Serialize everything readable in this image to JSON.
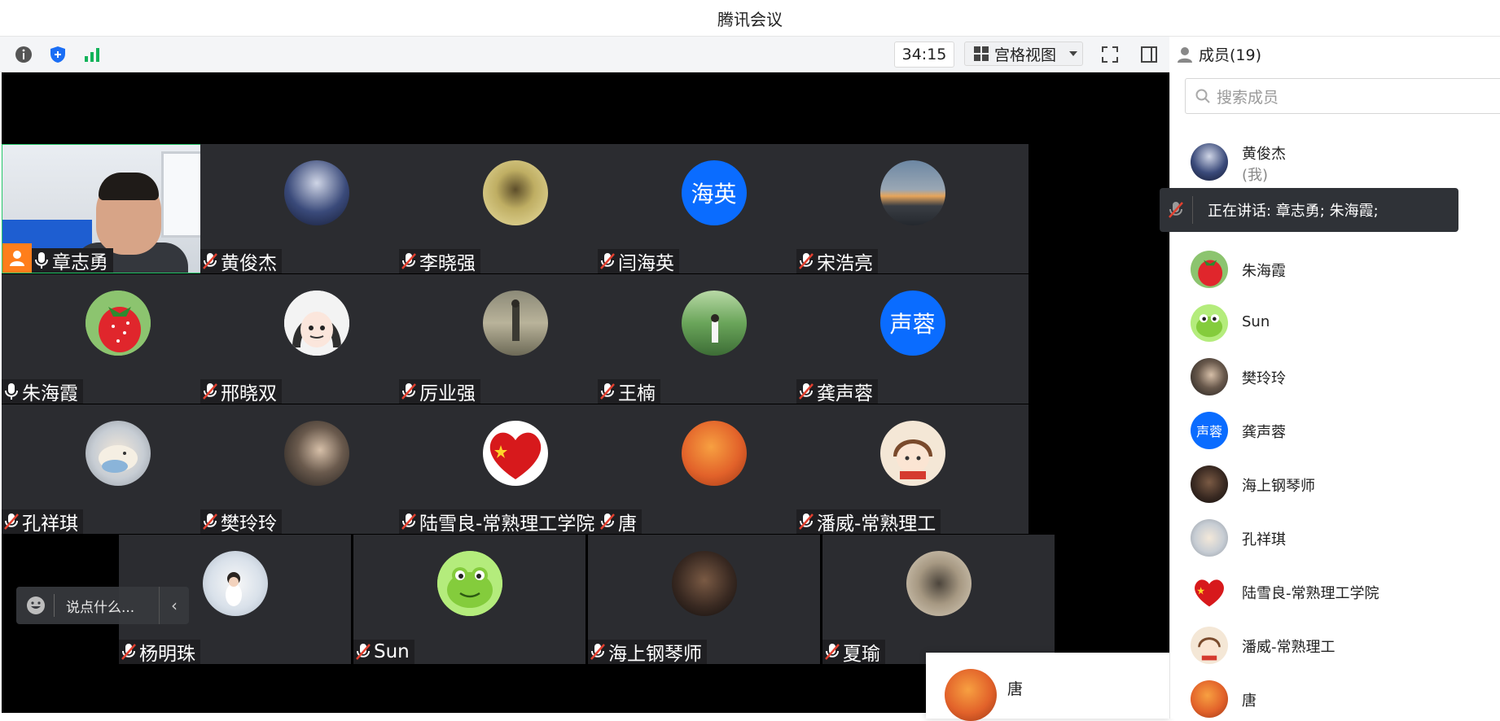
{
  "window": {
    "title": "腾讯会议"
  },
  "toolbar": {
    "timer": "34:15",
    "view_label": "宫格视图",
    "info_icon": "info-icon",
    "shield_icon": "shield-icon",
    "signal_icon": "signal-icon",
    "fullscreen_icon": "fullscreen-icon",
    "sidebar_icon": "sidebar-toggle-icon"
  },
  "members_panel": {
    "title": "成员(19)",
    "search_placeholder": "搜索成员",
    "speaking_toast": "正在讲话: 章志勇; 朱海霞;",
    "members": [
      {
        "name": "黄俊杰",
        "sub": "(我)"
      },
      {
        "name": "朱海霞"
      },
      {
        "name": "Sun"
      },
      {
        "name": "樊玲玲"
      },
      {
        "name": "龚声蓉",
        "avatar_text": "声蓉"
      },
      {
        "name": "海上钢琴师"
      },
      {
        "name": "孔祥琪"
      },
      {
        "name": "陆雪良-常熟理工学院"
      },
      {
        "name": "潘威-常熟理工"
      },
      {
        "name": "唐"
      }
    ]
  },
  "grid": {
    "tiles": [
      {
        "name": "章志勇",
        "mic": "on"
      },
      {
        "name": "黄俊杰",
        "mic": "off"
      },
      {
        "name": "李晓强",
        "mic": "off"
      },
      {
        "name": "闫海英",
        "mic": "off",
        "avatar_text": "海英"
      },
      {
        "name": "宋浩亮",
        "mic": "off"
      },
      {
        "name": "朱海霞",
        "mic": "on"
      },
      {
        "name": "邢晓双",
        "mic": "off"
      },
      {
        "name": "厉业强",
        "mic": "off"
      },
      {
        "name": "王楠",
        "mic": "off"
      },
      {
        "name": "龚声蓉",
        "mic": "off",
        "avatar_text": "声蓉"
      },
      {
        "name": "孔祥琪",
        "mic": "off"
      },
      {
        "name": "樊玲玲",
        "mic": "off"
      },
      {
        "name": "陆雪良-常熟理工学院",
        "mic": "off"
      },
      {
        "name": "唐",
        "mic": "off"
      },
      {
        "name": "潘威-常熟理工",
        "mic": "off"
      },
      {
        "name": "杨明珠",
        "mic": "off"
      },
      {
        "name": "Sun",
        "mic": "off"
      },
      {
        "name": "海上钢琴师",
        "mic": "off"
      },
      {
        "name": "夏瑜",
        "mic": "off"
      }
    ]
  },
  "chat": {
    "placeholder": "说点什么..."
  },
  "popup": {
    "name": "唐"
  },
  "colors": {
    "accent": "#0a6cff",
    "speaking_border": "#26c76b",
    "tile_bg": "#2b2c30"
  }
}
